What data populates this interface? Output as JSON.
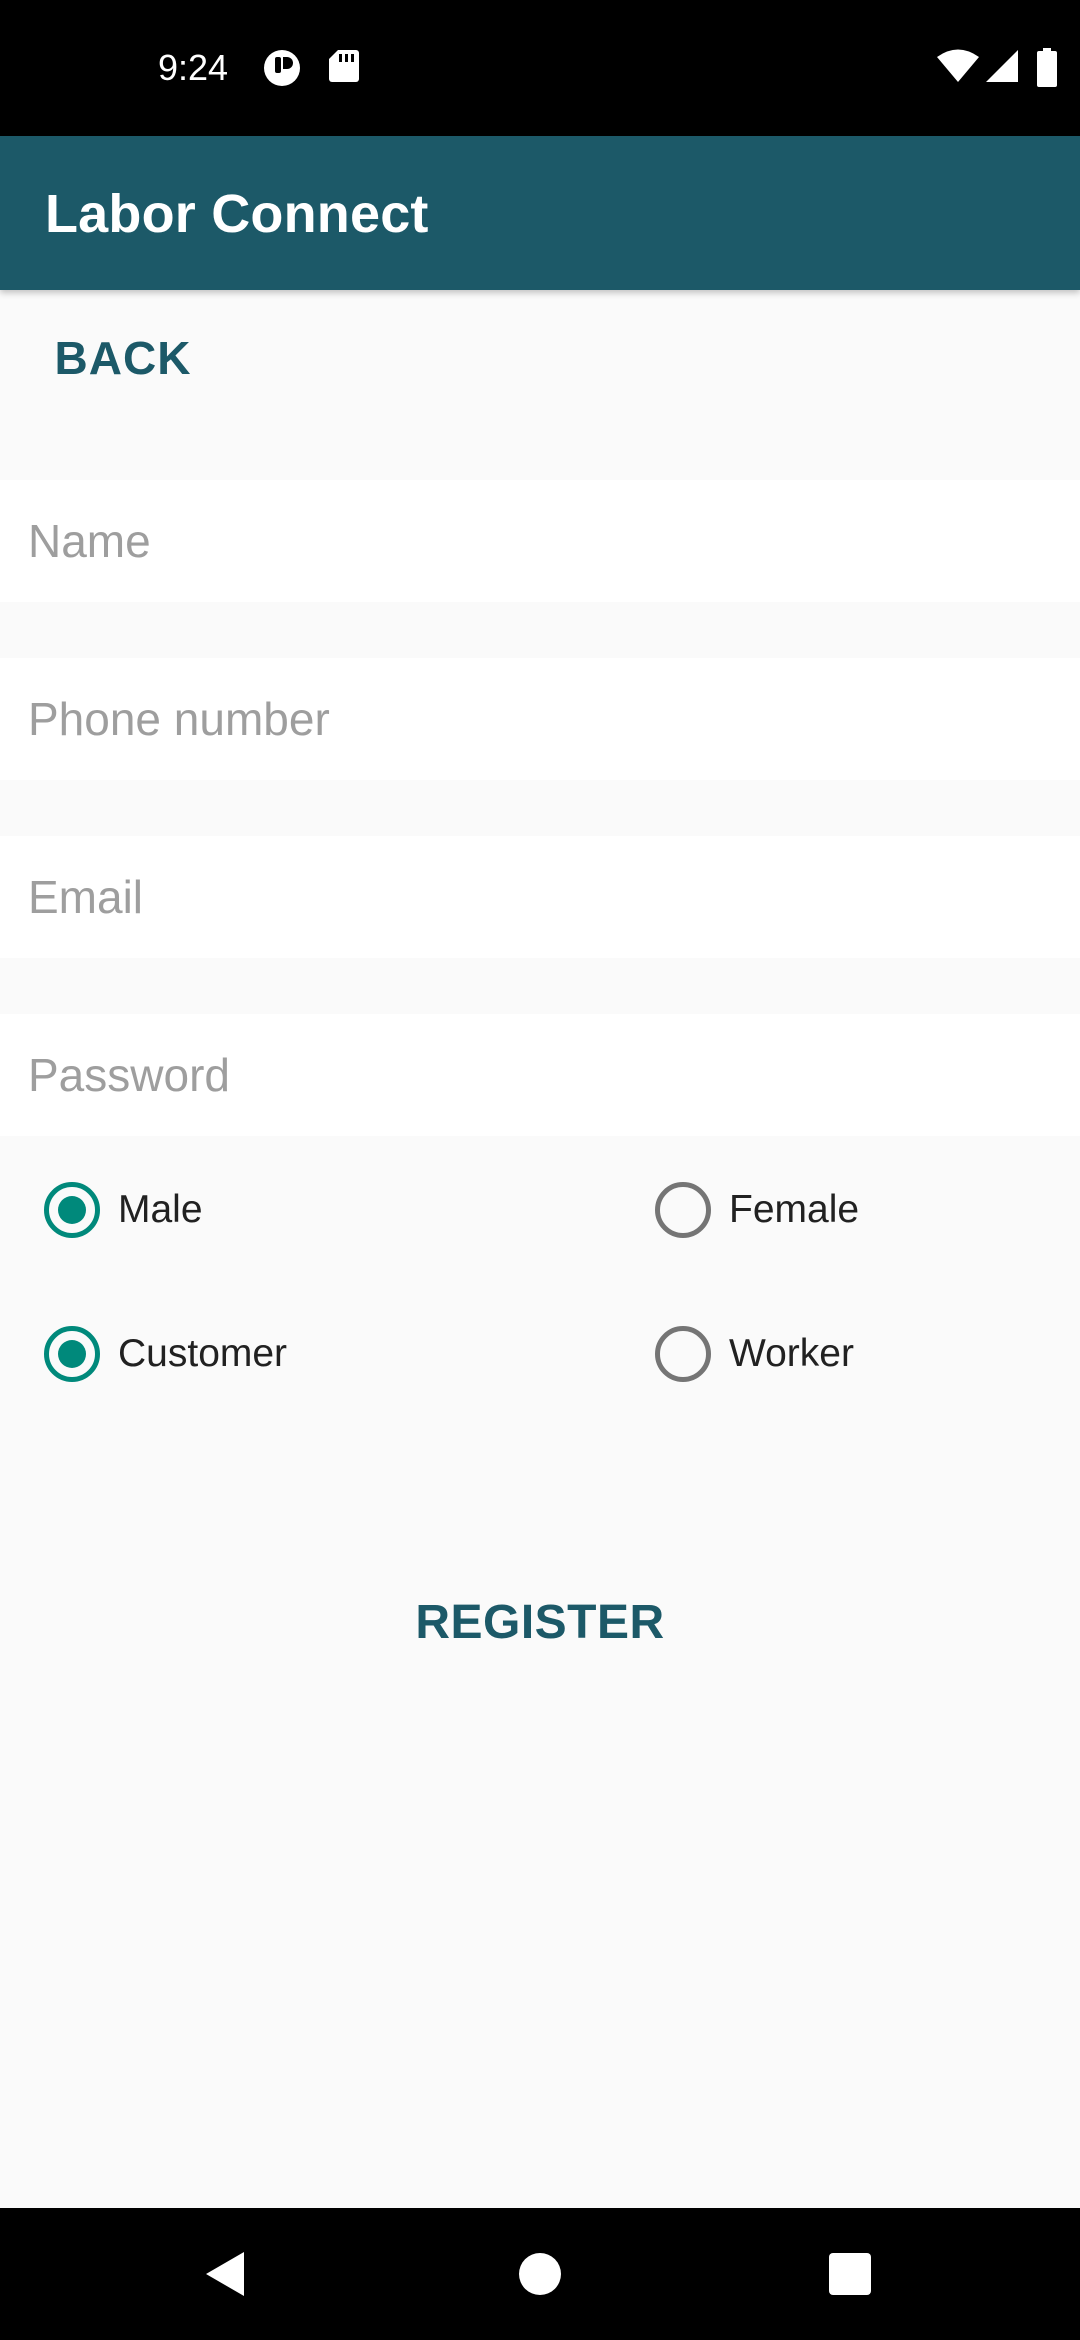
{
  "status_bar": {
    "time": "9:24",
    "icons": [
      "notification-app-icon",
      "sd-card-icon",
      "wifi-icon",
      "cell-signal-icon",
      "battery-icon"
    ]
  },
  "app_bar": {
    "title": "Labor Connect",
    "color": "#1c5968"
  },
  "back_label": "BACK",
  "form": {
    "name_placeholder": "Name",
    "name_value": "",
    "phone_placeholder": "Phone number",
    "phone_value": "",
    "email_placeholder": "Email",
    "email_value": "",
    "password_placeholder": "Password",
    "password_value": ""
  },
  "gender": {
    "options": [
      {
        "label": "Male",
        "checked": true
      },
      {
        "label": "Female",
        "checked": false
      }
    ]
  },
  "role": {
    "options": [
      {
        "label": "Customer",
        "checked": true
      },
      {
        "label": "Worker",
        "checked": false
      }
    ]
  },
  "register_label": "REGISTER",
  "accent_color": "#00897b",
  "nav_bar": {
    "buttons": [
      "back-triangle-icon",
      "home-circle-icon",
      "recents-square-icon"
    ]
  }
}
